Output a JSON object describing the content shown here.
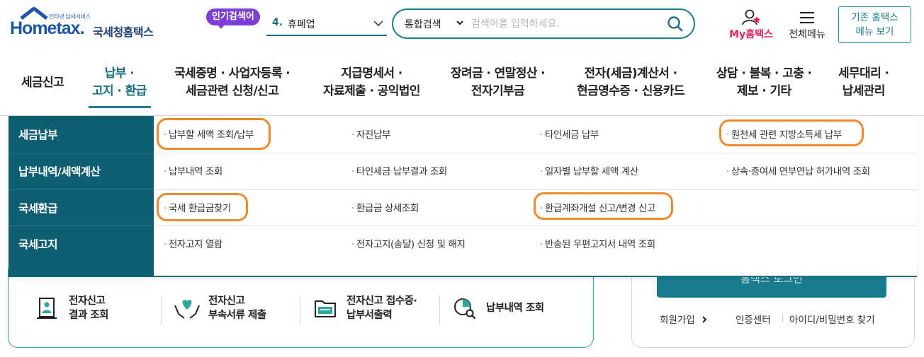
{
  "header": {
    "logo_small": "인터넷 납세서비스",
    "logo_main": "Hometax.",
    "logo_kr": "국세청홈택스",
    "popular_badge": "인기검색어",
    "popular_rank": "4.",
    "popular_word": "휴폐업",
    "search_category": "통합검색",
    "search_placeholder": "검색어를 입력하세요.",
    "mytax_label": "My홈택스",
    "allmenu_label": "전체메뉴",
    "oldhome_line1": "기존 홈택스",
    "oldhome_line2": "메뉴 보기"
  },
  "gnb": {
    "items": [
      {
        "line1": "세금신고",
        "line2": ""
      },
      {
        "line1": "납부 ·",
        "line2": "고지 · 환급"
      },
      {
        "line1": "국세증명 · 사업자등록 ·",
        "line2": "세금관련 신청/신고"
      },
      {
        "line1": "지급명세서 ·",
        "line2": "자료제출 · 공익법인"
      },
      {
        "line1": "장려금 · 연말정산 ·",
        "line2": "전자기부금"
      },
      {
        "line1": "전자(세금)계산서 ·",
        "line2": "현금영수증 · 신용카드"
      },
      {
        "line1": "상담 · 불복 · 고충 ·",
        "line2": "제보 · 기타"
      },
      {
        "line1": "세무대리 ·",
        "line2": "납세관리"
      }
    ],
    "active_index": 1
  },
  "submenu": {
    "rows": [
      {
        "category": "세금납부",
        "links": [
          "납부할 세액 조회/납부",
          "자진납부",
          "타인세금 납부",
          "원천세 관련 지방소득세 납부"
        ]
      },
      {
        "category": "납부내역/세액계산",
        "links": [
          "납부내역 조회",
          "타인세금 납부결과 조회",
          "일자별 납부할 세액 계산",
          "상속·증여세 연부연납 허가내역 조회"
        ]
      },
      {
        "category": "국세환급",
        "links": [
          "국세 환급금찾기",
          "환급금 상세조회",
          "환급계좌개설 신고/변경 신고"
        ]
      },
      {
        "category": "국세고지",
        "links": [
          "전자고지 열람",
          "전자고지(송달) 신청 및 해지",
          "반송된 우편고지서 내역 조회"
        ]
      }
    ],
    "highlighted": [
      "납부할 세액 조회/납부",
      "원천세 관련 지방소득세 납부",
      "국세 환급금찾기",
      "환급계좌개설 신고/변경 신고"
    ],
    "highlight_color": "#f08a2e",
    "category_bg": "#0e5f72"
  },
  "quick": {
    "items": [
      {
        "icon": "document-person-icon",
        "line1": "전자신고",
        "line2": "결과 조회"
      },
      {
        "icon": "heart-hands-icon",
        "line1": "전자신고",
        "line2": "부속서류 제출"
      },
      {
        "icon": "receipt-folder-icon",
        "line1": "전자신고 접수증·",
        "line2": "납부서출력"
      },
      {
        "icon": "chart-search-icon",
        "line1": "납부내역 조회",
        "line2": ""
      }
    ]
  },
  "login": {
    "button_label": "홈택스 로그인",
    "signup": "회원가입",
    "cert_center": "인증센터",
    "find_id": "아이디/비밀번호 찾기"
  },
  "colors": {
    "brand_teal": "#1a7d92",
    "badge_purple": "#7b3fd6",
    "mytax_pink": "#e0245e"
  }
}
